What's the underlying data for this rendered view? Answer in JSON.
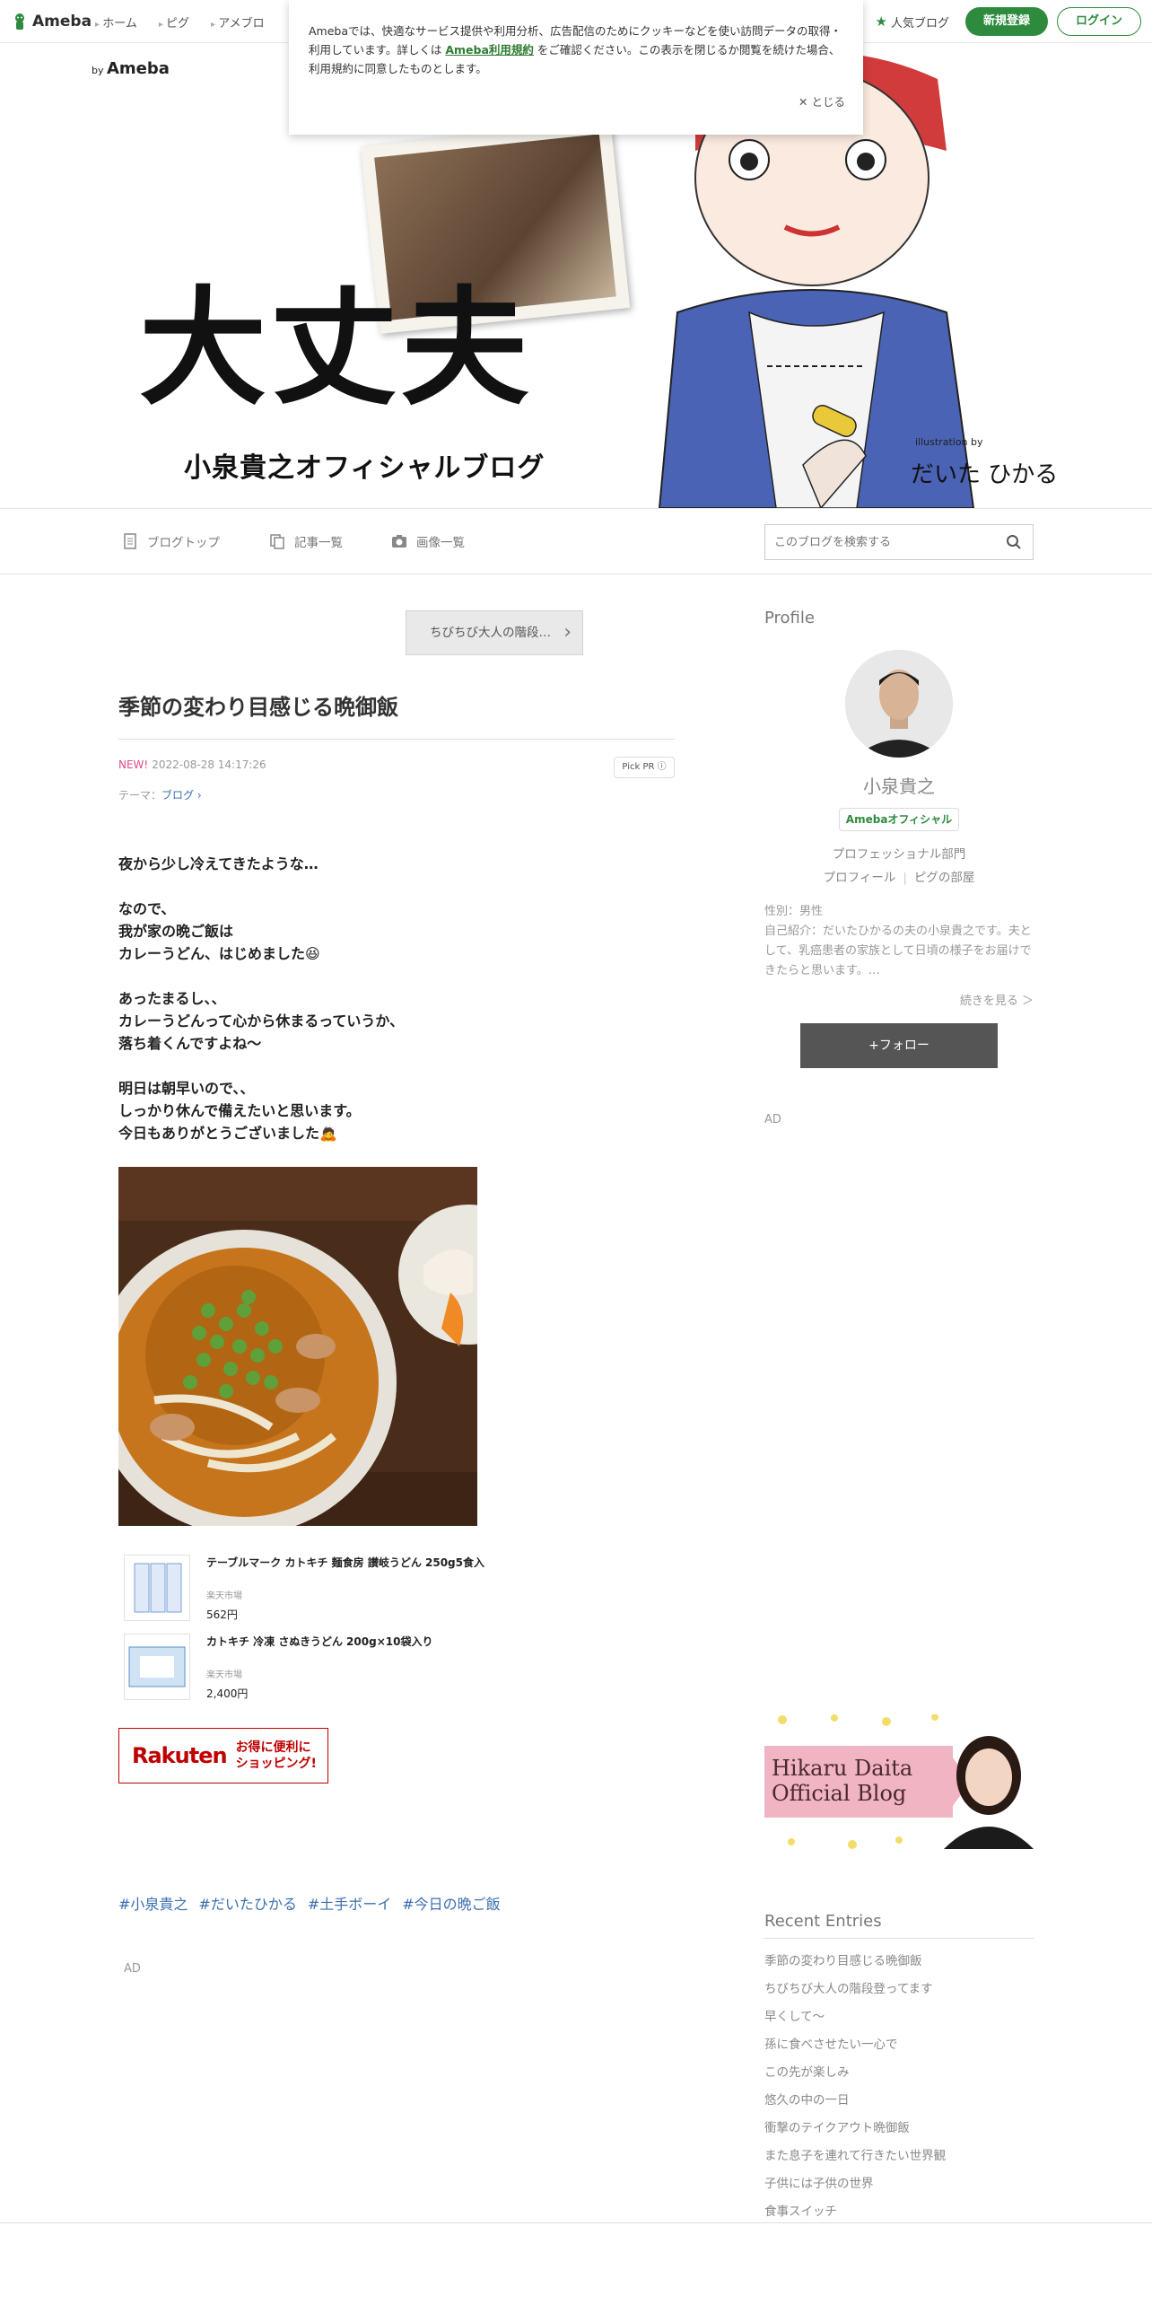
{
  "topbar": {
    "logo_text": "Ameba",
    "nav": [
      "ホーム",
      "ピグ",
      "アメブロ"
    ],
    "popular": "人気ブログ",
    "signup": "新規登録",
    "login": "ログイン"
  },
  "cookie": {
    "text_before": "Amebaでは、快適なサービス提供や利用分析、広告配信のためにクッキーなどを使い訪問データの取得・利用しています。詳しくは ",
    "link": "Ameba利用規約",
    "text_after": " をご確認ください。この表示を閉じるか閲覧を続けた場合、利用規約に同意したものとします。",
    "close": "とじる"
  },
  "banner": {
    "by": "by",
    "brand": "Ameba",
    "title": "大丈夫",
    "subtitle": "小泉貴之オフィシャルブログ",
    "credit": "illustration by",
    "sign": "だいた ひかる"
  },
  "blognav": {
    "top": "ブログトップ",
    "list": "記事一覧",
    "images": "画像一覧",
    "search_placeholder": "このブログを検索する"
  },
  "entry": {
    "prev": "ちびちび大人の階段…",
    "title": "季節の変わり目感じる晩御飯",
    "new_label": "NEW!",
    "datetime": "2022-08-28 14:17:26",
    "pickpr": "Pick PR ⓘ",
    "theme_label": "テーマ：",
    "theme": "ブログ",
    "body": "夜から少し冷えてきたような…\n\nなので、\n我が家の晩ご飯は\nカレーうどん、はじめました😆\n\nあったまるし、、\nカレーうどんって心から休まるっていうか、\n落ち着くんですよね〜\n\n明日は朝早いので、、\nしっかり休んで備えたいと思います。\n今日もありがとうございました🙇",
    "products": [
      {
        "name": "テーブルマーク カトキチ 麺食房 讃岐うどん 250g5食入",
        "shop": "楽天市場",
        "price": "562円"
      },
      {
        "name": "カトキチ 冷凍 さぬきうどん 200g×10袋入り",
        "shop": "楽天市場",
        "price": "2,400円"
      }
    ],
    "rakuten_logo": "Rakuten",
    "rakuten_promo1": "お得に便利に",
    "rakuten_promo2": "ショッピング!",
    "hashtags": [
      "#小泉貴之",
      "#だいたひかる",
      "#土手ボーイ",
      "#今日の晩ご飯"
    ],
    "ad": "AD"
  },
  "sidebar": {
    "profile_heading": "Profile",
    "name": "小泉貴之",
    "official": "Amebaオフィシャル",
    "category": "プロフェッショナル部門",
    "profile_link": "プロフィール",
    "pig_link": "ピグの部屋",
    "gender": "性別：男性",
    "intro": "自己紹介：だいたひかるの夫の小泉貴之です。夫として、乳癌患者の家族として日頃の様子をお届けできたらと思います。…",
    "more": "続きを見る ＞",
    "follow": "+フォロー",
    "ad": "AD",
    "hikaru_line1": "Hikaru Daita",
    "hikaru_line2": "Official Blog",
    "recent_heading": "Recent Entries",
    "recent": [
      "季節の変わり目感じる晩御飯",
      "ちびちび大人の階段登ってます",
      "早くして〜",
      "孫に食べさせたい一心で",
      "この先が楽しみ",
      "悠久の中の一日",
      "衝撃のテイクアウト晩御飯",
      "また息子を連れて行きたい世界観",
      "子供には子供の世界",
      "食事スイッチ"
    ]
  }
}
